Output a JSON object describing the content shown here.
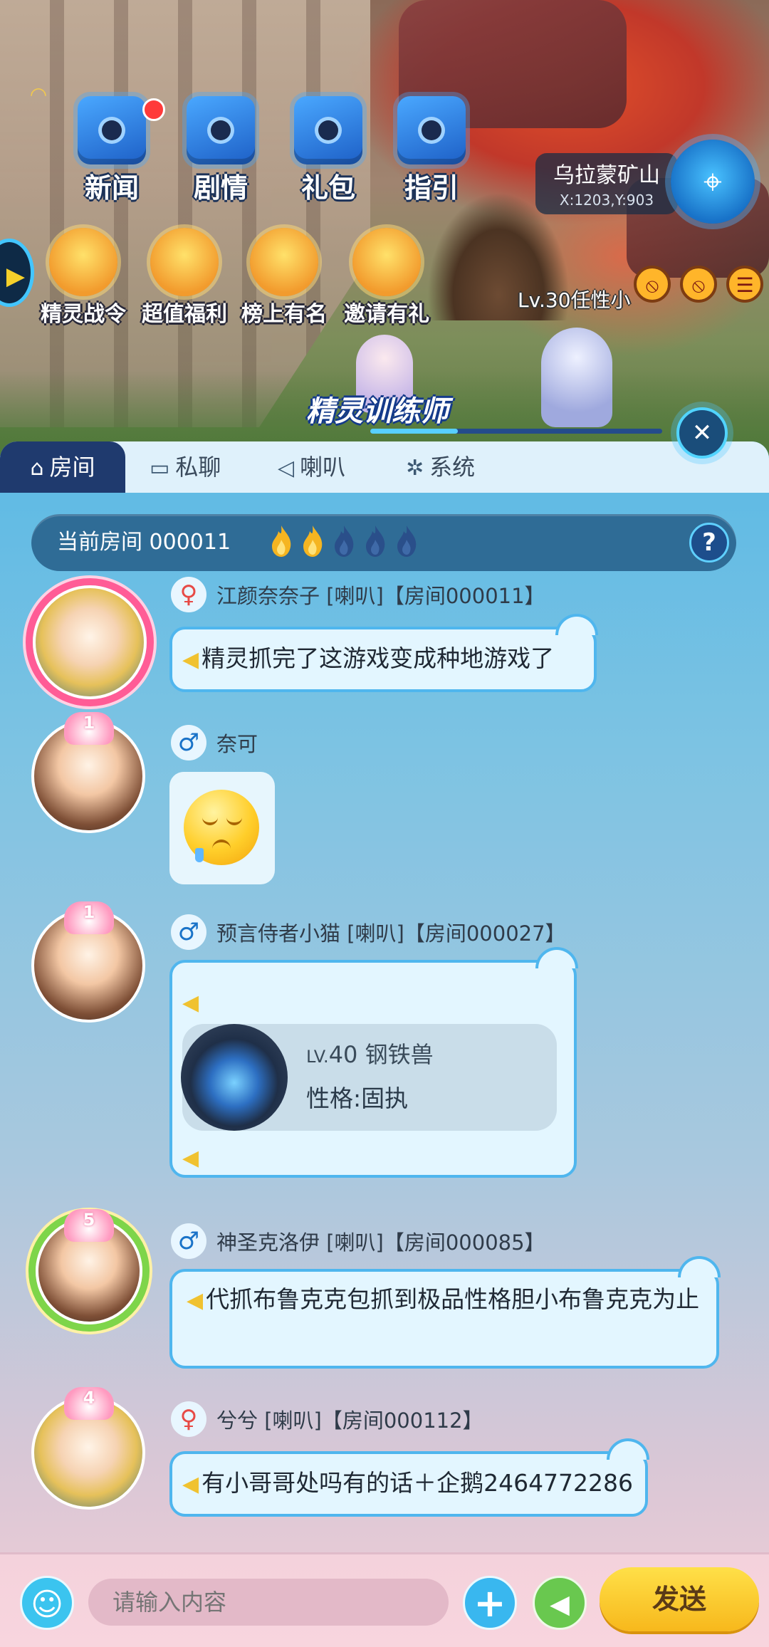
{
  "scene": {
    "top_buttons": [
      {
        "label": "新闻"
      },
      {
        "label": "剧情"
      },
      {
        "label": "礼包"
      },
      {
        "label": "指引"
      }
    ],
    "location": {
      "name": "乌拉蒙矿山",
      "coord": "X:1203,Y:903"
    },
    "events": [
      {
        "label": "精灵战令"
      },
      {
        "label": "超值福利"
      },
      {
        "label": "榜上有名"
      },
      {
        "label": "邀请有礼"
      }
    ],
    "player_label": "Lv.30任性小",
    "trainer_title": "精灵训练师",
    "progress_fraction": 0.3
  },
  "tabs": [
    {
      "label": "房间",
      "icon": "home-icon",
      "active": true
    },
    {
      "label": "私聊",
      "icon": "monitor-icon",
      "active": false
    },
    {
      "label": "喇叭",
      "icon": "horn-icon",
      "active": false
    },
    {
      "label": "系统",
      "icon": "pinwheel-icon",
      "active": false
    }
  ],
  "room": {
    "label": "当前房间 000011",
    "flames_lit": 2,
    "flames_total": 5,
    "help": "?"
  },
  "messages": [
    {
      "gender": "female",
      "gender_symbol": "♀",
      "name": "江颜奈奈子 [喇叭]【房间000011】",
      "text": "精灵抓完了这游戏变成种地游戏了"
    },
    {
      "gender": "male",
      "gender_symbol": "♂",
      "name": "奈可",
      "crown": "1",
      "sticker": "sleepy-smile-emoji"
    },
    {
      "gender": "male",
      "gender_symbol": "♂",
      "name": "预言侍者小猫 [喇叭]【房间000027】",
      "crown": "1",
      "pet": {
        "level_prefix": "LV.",
        "level": "40",
        "name": "钢铁兽",
        "nature": "性格:固执"
      }
    },
    {
      "gender": "male",
      "gender_symbol": "♂",
      "name": "神圣克洛伊 [喇叭]【房间000085】",
      "crown": "5",
      "text": "代抓布鲁克克包抓到极品性格胆小布鲁克克为止"
    },
    {
      "gender": "female",
      "gender_symbol": "♀",
      "name": "兮兮 [喇叭]【房间000112】",
      "crown": "4",
      "text": "有小哥哥处吗有的话＋企鹅2464772286"
    }
  ],
  "input": {
    "placeholder": "请输入内容",
    "send": "发送"
  },
  "colors": {
    "tab_active": "#1f3a6e",
    "bubble_border": "#4fb6ee",
    "send_button": "#f7b81c",
    "flame_lit": "#f5b521",
    "flame_unlit": "#2a4f8a"
  }
}
